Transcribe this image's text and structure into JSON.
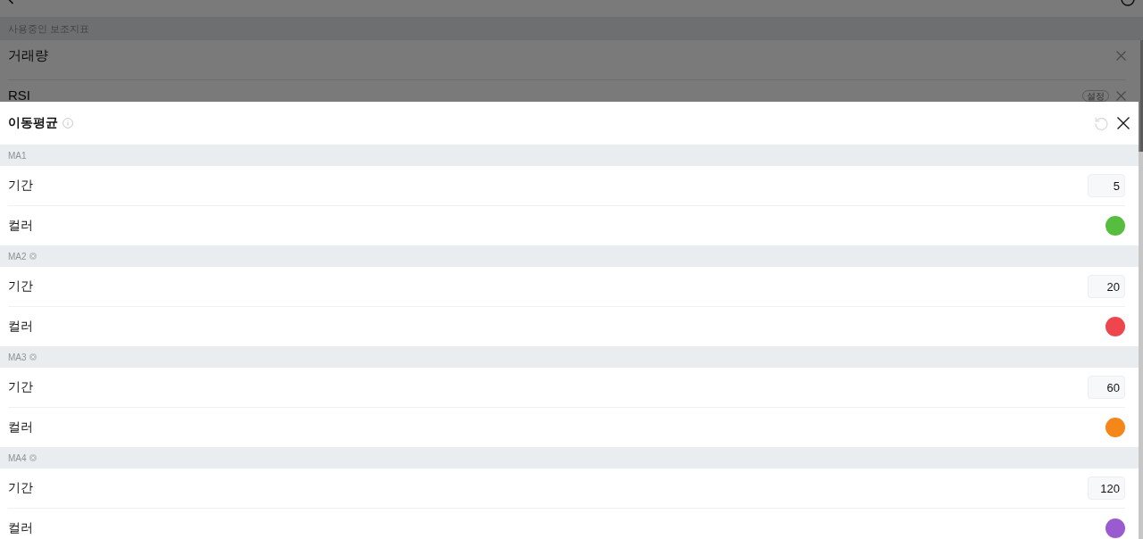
{
  "background_page": {
    "section_label": "사용중인 보조지표",
    "indicators": [
      {
        "name": "거래량"
      },
      {
        "name": "RSI",
        "settings_label": "설정"
      }
    ]
  },
  "dialog": {
    "title": "이동평균",
    "reset_disabled": true,
    "groups": [
      {
        "label": "MA1",
        "removable": false,
        "rows": [
          {
            "kind": "number",
            "label": "기간",
            "value": "5"
          },
          {
            "kind": "color",
            "label": "컬러",
            "color": "#57bd3e"
          }
        ]
      },
      {
        "label": "MA2",
        "removable": true,
        "rows": [
          {
            "kind": "number",
            "label": "기간",
            "value": "20"
          },
          {
            "kind": "color",
            "label": "컬러",
            "color": "#ef464d"
          }
        ]
      },
      {
        "label": "MA3",
        "removable": true,
        "rows": [
          {
            "kind": "number",
            "label": "기간",
            "value": "60"
          },
          {
            "kind": "color",
            "label": "컬러",
            "color": "#f5861a"
          }
        ]
      },
      {
        "label": "MA4",
        "removable": true,
        "rows": [
          {
            "kind": "number",
            "label": "기간",
            "value": "120"
          },
          {
            "kind": "color",
            "label": "컬러",
            "color": "#9b5bd0"
          }
        ]
      }
    ]
  }
}
